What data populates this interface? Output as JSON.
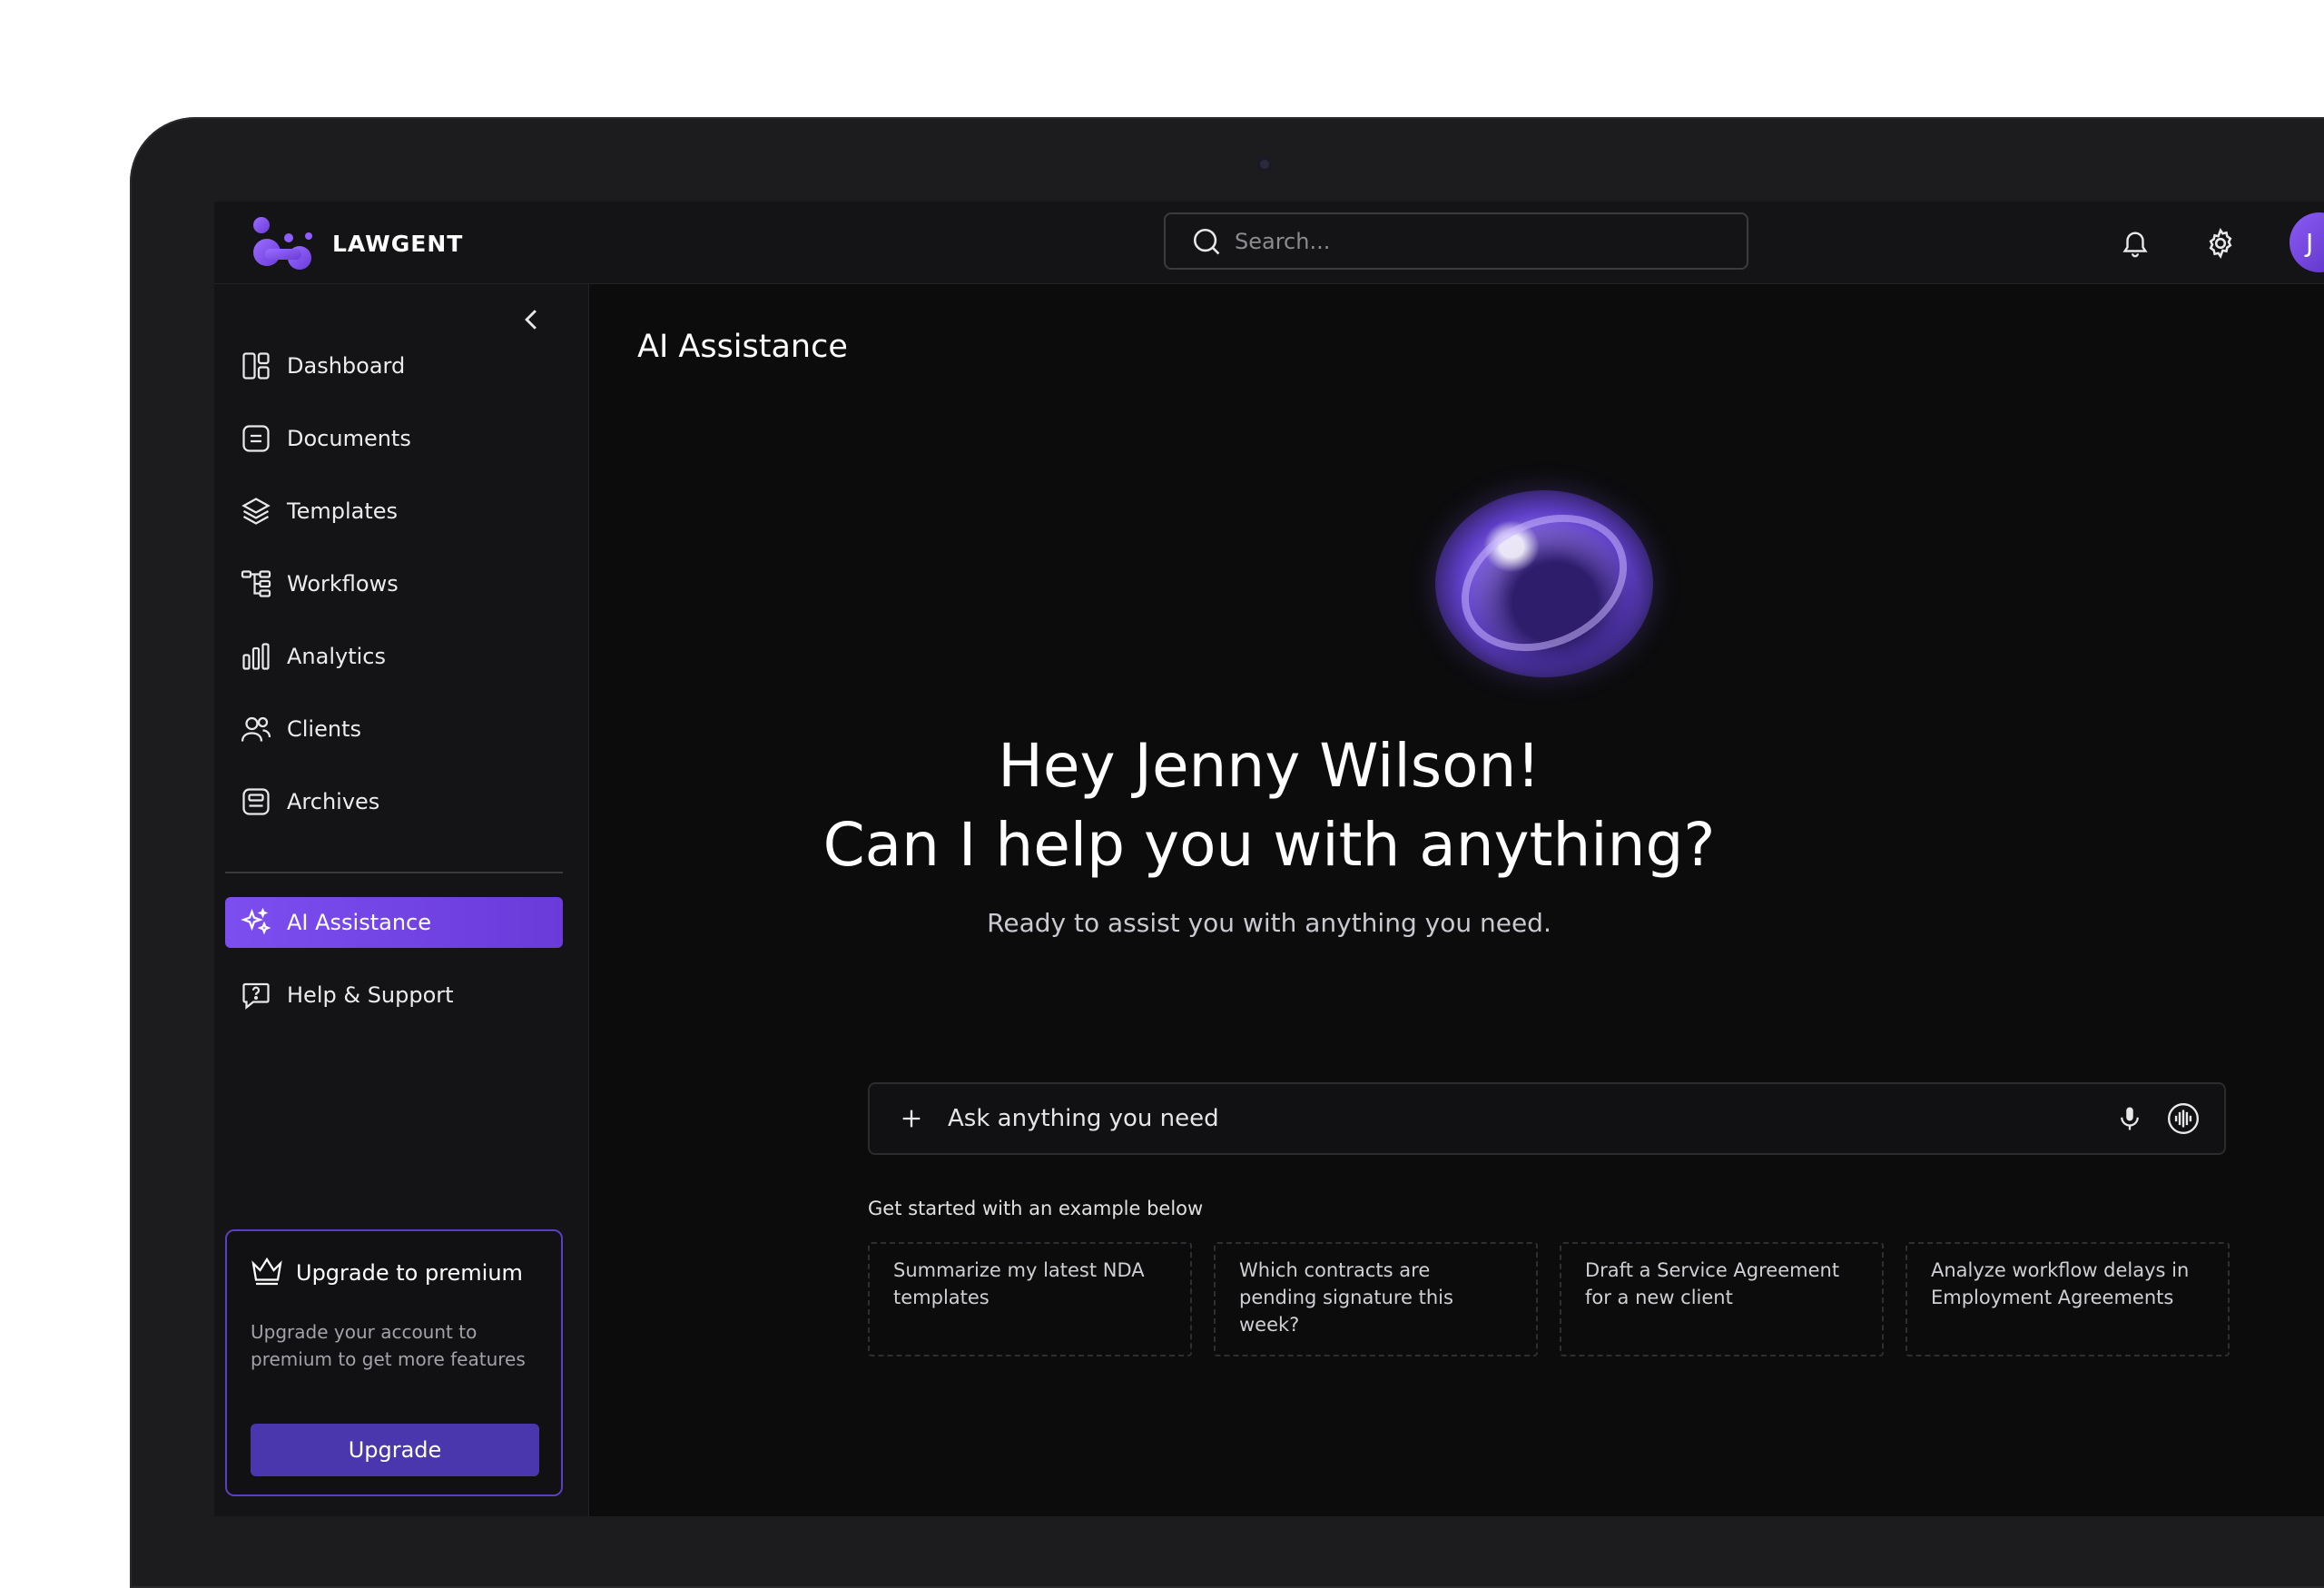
{
  "app": {
    "brand": "LAWGENT"
  },
  "topbar": {
    "search_placeholder": "Search...",
    "avatar_initial": "J"
  },
  "sidebar": {
    "items": [
      {
        "label": "Dashboard",
        "icon": "dashboard-icon"
      },
      {
        "label": "Documents",
        "icon": "document-icon"
      },
      {
        "label": "Templates",
        "icon": "layers-icon"
      },
      {
        "label": "Workflows",
        "icon": "workflow-icon"
      },
      {
        "label": "Analytics",
        "icon": "bar-chart-icon"
      },
      {
        "label": "Clients",
        "icon": "users-icon"
      },
      {
        "label": "Archives",
        "icon": "archive-icon"
      }
    ],
    "ai_item": {
      "label": "AI Assistance",
      "icon": "sparkles-icon"
    },
    "help_item": {
      "label": "Help & Support",
      "icon": "help-chat-icon"
    },
    "premium": {
      "title": "Upgrade to premium",
      "description": "Upgrade your account to premium to get more features",
      "button": "Upgrade"
    }
  },
  "main": {
    "title": "AI Assistance",
    "greeting_line1": "Hey Jenny Wilson!",
    "greeting_line2": "Can I help you with anything?",
    "subtitle": "Ready to assist you with anything you need.",
    "ask_placeholder": "Ask anything you need",
    "examples_label": "Get started with an example below",
    "examples": [
      "Summarize my latest NDA templates",
      "Which contracts are pending signature this week?",
      "Draft a Service Agreement for a new client",
      "Analyze workflow delays in Employment Agreements"
    ]
  },
  "colors": {
    "accent": "#7c4ef0",
    "upgrade": "#4a37ae",
    "background": "#0c0c0d",
    "panel": "#141416"
  }
}
